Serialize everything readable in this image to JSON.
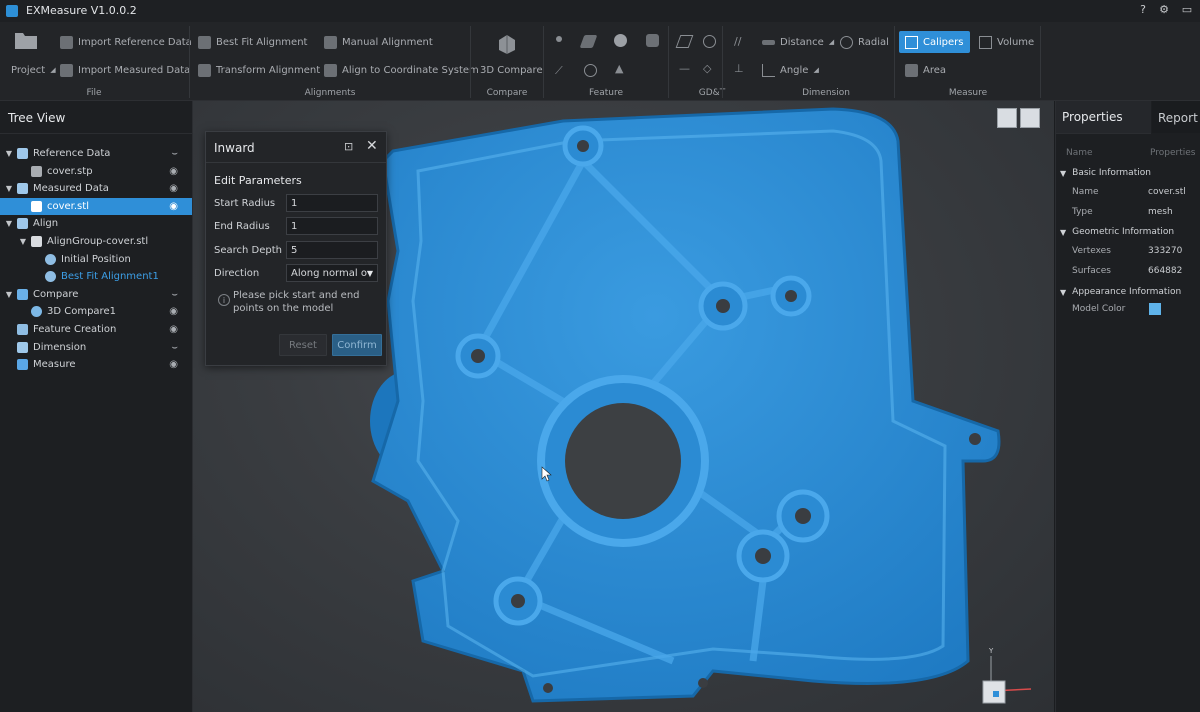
{
  "app": {
    "title": "EXMeasure V1.0.0.2"
  },
  "titlebar_icons": [
    "help-icon",
    "gear-icon",
    "minimize-icon",
    "maximize-icon",
    "close-icon"
  ],
  "ribbon": {
    "file": {
      "label": "File",
      "project": "Project",
      "import_reference": "Import Reference Data",
      "import_measured": "Import Measured Data"
    },
    "alignments": {
      "label": "Alignments",
      "best_fit": "Best Fit Alignment",
      "manual": "Manual Alignment",
      "transform": "Transform Alignment",
      "align_coord": "Align to Coordinate System"
    },
    "compare": {
      "label": "Compare",
      "compare3d": "3D Compare"
    },
    "feature": {
      "label": "Feature"
    },
    "gdt": {
      "label": "GD&T"
    },
    "dimension": {
      "label": "Dimension",
      "distance": "Distance",
      "radial": "Radial",
      "angle": "Angle"
    },
    "measure": {
      "label": "Measure",
      "calipers": "Calipers",
      "volume": "Volume",
      "area": "Area"
    }
  },
  "tree": {
    "title": "Tree View",
    "items": [
      {
        "label": "Reference Data",
        "level": 0,
        "expanded": true,
        "icon": "reference-data-icon",
        "vis": "eye-closed-icon",
        "selected": false
      },
      {
        "label": "cover.stp",
        "level": 1,
        "icon": "cube-icon",
        "vis": "eye-icon",
        "selected": false
      },
      {
        "label": "Measured Data",
        "level": 0,
        "expanded": true,
        "icon": "measured-data-icon",
        "vis": "eye-icon",
        "selected": false
      },
      {
        "label": "cover.stl",
        "level": 1,
        "icon": "mesh-icon",
        "vis": "eye-icon",
        "selected": true
      },
      {
        "label": "Align",
        "level": 0,
        "expanded": true,
        "icon": "align-icon",
        "vis": "",
        "selected": false
      },
      {
        "label": "AlignGroup-cover.stl",
        "level": 1,
        "expanded": true,
        "icon": "folder-icon",
        "vis": "",
        "selected": false
      },
      {
        "label": "Initial Position",
        "level": 2,
        "icon": "globe-icon",
        "vis": "",
        "selected": false
      },
      {
        "label": "Best Fit Alignment1",
        "level": 2,
        "icon": "globe-icon",
        "vis": "",
        "selected": false,
        "active": true
      },
      {
        "label": "Compare",
        "level": 0,
        "expanded": true,
        "icon": "compare-icon",
        "vis": "eye-closed-icon",
        "selected": false
      },
      {
        "label": "3D Compare1",
        "level": 1,
        "icon": "compare-result-icon",
        "vis": "eye-icon",
        "selected": false
      },
      {
        "label": "Feature Creation",
        "level": 0,
        "icon": "feature-icon",
        "vis": "eye-icon",
        "selected": false
      },
      {
        "label": "Dimension",
        "level": 0,
        "icon": "dimension-icon",
        "vis": "eye-closed-icon",
        "selected": false
      },
      {
        "label": "Measure",
        "level": 0,
        "icon": "measure-icon",
        "vis": "eye-icon",
        "selected": false
      }
    ]
  },
  "dialog": {
    "title": "Inward",
    "section": "Edit Parameters",
    "fields": [
      {
        "label": "Start Radius",
        "value": "1"
      },
      {
        "label": "End Radius",
        "value": "1"
      },
      {
        "label": "Search Depth",
        "value": "5"
      },
      {
        "label": "Direction",
        "value": "Along normal of s"
      }
    ],
    "hint": "Please pick start and end points on the model",
    "reset": "Reset",
    "confirm": "Confirm"
  },
  "properties": {
    "tabs": [
      "Properties",
      "Report"
    ],
    "col_name": "Name",
    "col_value": "Properties",
    "basic": {
      "title": "Basic Information",
      "name_key": "Name",
      "name_val": "cover.stl",
      "type_key": "Type",
      "type_val": "mesh"
    },
    "geometric": {
      "title": "Geometric Information",
      "vert_key": "Vertexes",
      "vert_val": "333270",
      "surf_key": "Surfaces",
      "surf_val": "664882"
    },
    "appearance": {
      "title": "Appearance Information",
      "color_key": "Model Color",
      "color_val": "#5fb3ea"
    }
  },
  "viewport": {
    "axis_y": "Y",
    "model_color": "#2f8fd8"
  }
}
